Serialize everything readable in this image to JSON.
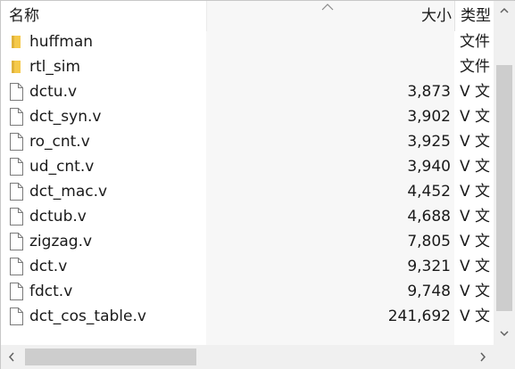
{
  "header": {
    "name_label": "名称",
    "size_label": "大小",
    "type_label": "类型"
  },
  "files": [
    {
      "name": "huffman",
      "size": "",
      "type": "文件",
      "icon": "folder-icon"
    },
    {
      "name": "rtl_sim",
      "size": "",
      "type": "文件",
      "icon": "folder-icon"
    },
    {
      "name": "dctu.v",
      "size": "3,873",
      "type": "V 文",
      "icon": "file-icon"
    },
    {
      "name": "dct_syn.v",
      "size": "3,902",
      "type": "V 文",
      "icon": "file-icon"
    },
    {
      "name": "ro_cnt.v",
      "size": "3,925",
      "type": "V 文",
      "icon": "file-icon"
    },
    {
      "name": "ud_cnt.v",
      "size": "3,940",
      "type": "V 文",
      "icon": "file-icon"
    },
    {
      "name": "dct_mac.v",
      "size": "4,452",
      "type": "V 文",
      "icon": "file-icon"
    },
    {
      "name": "dctub.v",
      "size": "4,688",
      "type": "V 文",
      "icon": "file-icon"
    },
    {
      "name": "zigzag.v",
      "size": "7,805",
      "type": "V 文",
      "icon": "file-icon"
    },
    {
      "name": "dct.v",
      "size": "9,321",
      "type": "V 文",
      "icon": "file-icon"
    },
    {
      "name": "fdct.v",
      "size": "9,748",
      "type": "V 文",
      "icon": "file-icon"
    },
    {
      "name": "dct_cos_table.v",
      "size": "241,692",
      "type": "V 文",
      "icon": "file-icon"
    }
  ],
  "colors": {
    "folder": "#f5c94a",
    "file_outline": "#7a7a7a",
    "size_column_bg": "#f7f7f7",
    "scroll_thumb": "#cdcdcd"
  }
}
